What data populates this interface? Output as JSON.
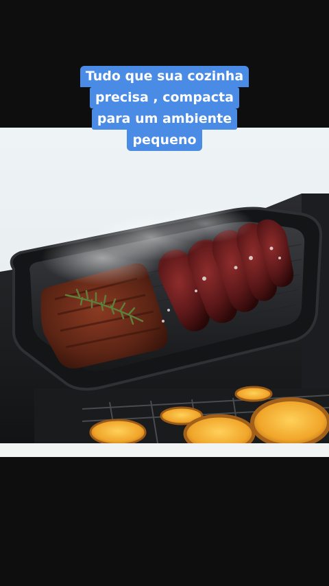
{
  "caption": {
    "lines": [
      "Tudo que sua cozinha",
      "precisa , compacta",
      "para um ambiente",
      "pequeno"
    ]
  },
  "colors": {
    "caption_bg": "#4a8be6",
    "caption_text": "#ffffff",
    "background": "#0e0e0f"
  },
  "media": {
    "icon": "product-photo-grill-oven"
  }
}
